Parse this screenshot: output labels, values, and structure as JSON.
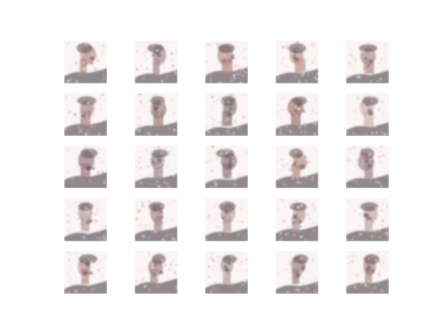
{
  "figure": {
    "rows": 5,
    "cols": 5,
    "tiles": [
      {
        "variant": "portrait-a",
        "tone": "#b98c8a"
      },
      {
        "variant": "portrait-b",
        "tone": "#a98a8e"
      },
      {
        "variant": "portrait-c",
        "tone": "#b58b86"
      },
      {
        "variant": "portrait-a",
        "tone": "#c0958c"
      },
      {
        "variant": "portrait-d",
        "tone": "#b38f8f"
      },
      {
        "variant": "portrait-b",
        "tone": "#a8878f"
      },
      {
        "variant": "portrait-c",
        "tone": "#9b7f7f"
      },
      {
        "variant": "portrait-d",
        "tone": "#8e7a76"
      },
      {
        "variant": "portrait-e",
        "tone": "#a07f78"
      },
      {
        "variant": "portrait-f",
        "tone": "#c8b7b3"
      },
      {
        "variant": "portrait-d",
        "tone": "#9a7c83"
      },
      {
        "variant": "portrait-c",
        "tone": "#a08a8b"
      },
      {
        "variant": "portrait-b",
        "tone": "#8d7478"
      },
      {
        "variant": "portrait-a",
        "tone": "#b29183"
      },
      {
        "variant": "portrait-c",
        "tone": "#a6888d"
      },
      {
        "variant": "portrait-f",
        "tone": "#b79e9a"
      },
      {
        "variant": "portrait-b",
        "tone": "#a28384"
      },
      {
        "variant": "portrait-e",
        "tone": "#b59c9c"
      },
      {
        "variant": "portrait-a",
        "tone": "#b89897"
      },
      {
        "variant": "portrait-f",
        "tone": "#c3a6a2"
      },
      {
        "variant": "portrait-c",
        "tone": "#b38f84"
      },
      {
        "variant": "portrait-d",
        "tone": "#a78a8a"
      },
      {
        "variant": "portrait-a",
        "tone": "#b19c9a"
      },
      {
        "variant": "portrait-b",
        "tone": "#9f8281"
      },
      {
        "variant": "portrait-e",
        "tone": "#af8f88"
      }
    ]
  }
}
